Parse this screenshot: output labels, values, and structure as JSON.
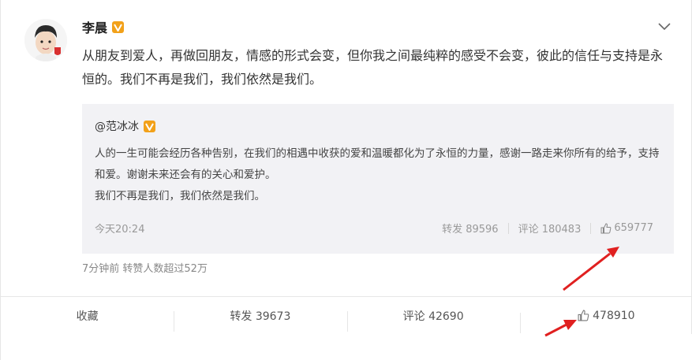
{
  "post": {
    "author": "李晨",
    "text": "从朋友到爱人，再做回朋友，情感的形式会变，但你我之间最纯粹的感受不会变，彼此的信任与支持是永恒的。我们不再是我们，我们依然是我们。",
    "meta": "7分钟前  转赞人数超过52万"
  },
  "quote": {
    "author": "@范冰冰",
    "line1": "人的一生可能会经历各种告别，在我们的相遇中收获的爱和温暖都化为了永恒的力量，感谢一路走来你所有的给予，支持和爱。谢谢未来还会有的关心和爱护。",
    "line2": "我们不再是我们，我们依然是我们。",
    "time": "今天20:24",
    "repost": "转发 89596",
    "comment": "评论 180483",
    "likes": "659777"
  },
  "footer": {
    "favorite": "收藏",
    "repost": "转发 39673",
    "comment": "评论 42690",
    "likes": "478910"
  },
  "icons": {
    "verified": "verified-badge-icon",
    "chevron": "chevron-down-icon",
    "like": "thumbs-up-icon"
  },
  "colors": {
    "badge": "#f2a11a",
    "arrow": "#e02020",
    "quote_bg": "#f2f2f5"
  }
}
